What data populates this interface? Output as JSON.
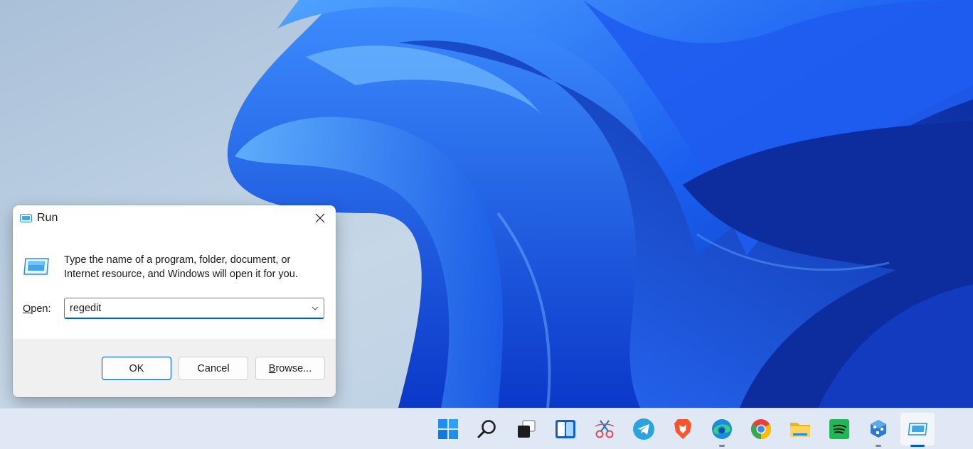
{
  "dialog": {
    "title": "Run",
    "description_line1": "Type the name of a program, folder, document, or",
    "description_line2": "Internet resource, and Windows will open it for you.",
    "open_label": "Open:",
    "open_value": "regedit",
    "ok_label": "OK",
    "cancel_label": "Cancel",
    "browse_label": "Browse..."
  },
  "taskbar": {
    "items": [
      {
        "name": "start",
        "icon": "windows-logo-icon"
      },
      {
        "name": "search",
        "icon": "search-icon"
      },
      {
        "name": "task-view",
        "icon": "task-view-icon"
      },
      {
        "name": "widgets",
        "icon": "widgets-icon"
      },
      {
        "name": "snipping-tool",
        "icon": "scissors-icon"
      },
      {
        "name": "telegram",
        "icon": "telegram-icon"
      },
      {
        "name": "brave",
        "icon": "brave-lion-icon"
      },
      {
        "name": "edge",
        "icon": "edge-icon",
        "running": true
      },
      {
        "name": "chrome",
        "icon": "chrome-icon"
      },
      {
        "name": "file-explorer",
        "icon": "folder-icon"
      },
      {
        "name": "spotify",
        "icon": "spotify-icon"
      },
      {
        "name": "teams-network",
        "icon": "network-cube-icon",
        "running": true
      },
      {
        "name": "run",
        "icon": "run-icon",
        "active": true
      }
    ]
  },
  "colors": {
    "accent": "#005fb8",
    "wallpaper_blue": "#1a4fe0",
    "taskbar_bg": "#dfe8f4"
  }
}
